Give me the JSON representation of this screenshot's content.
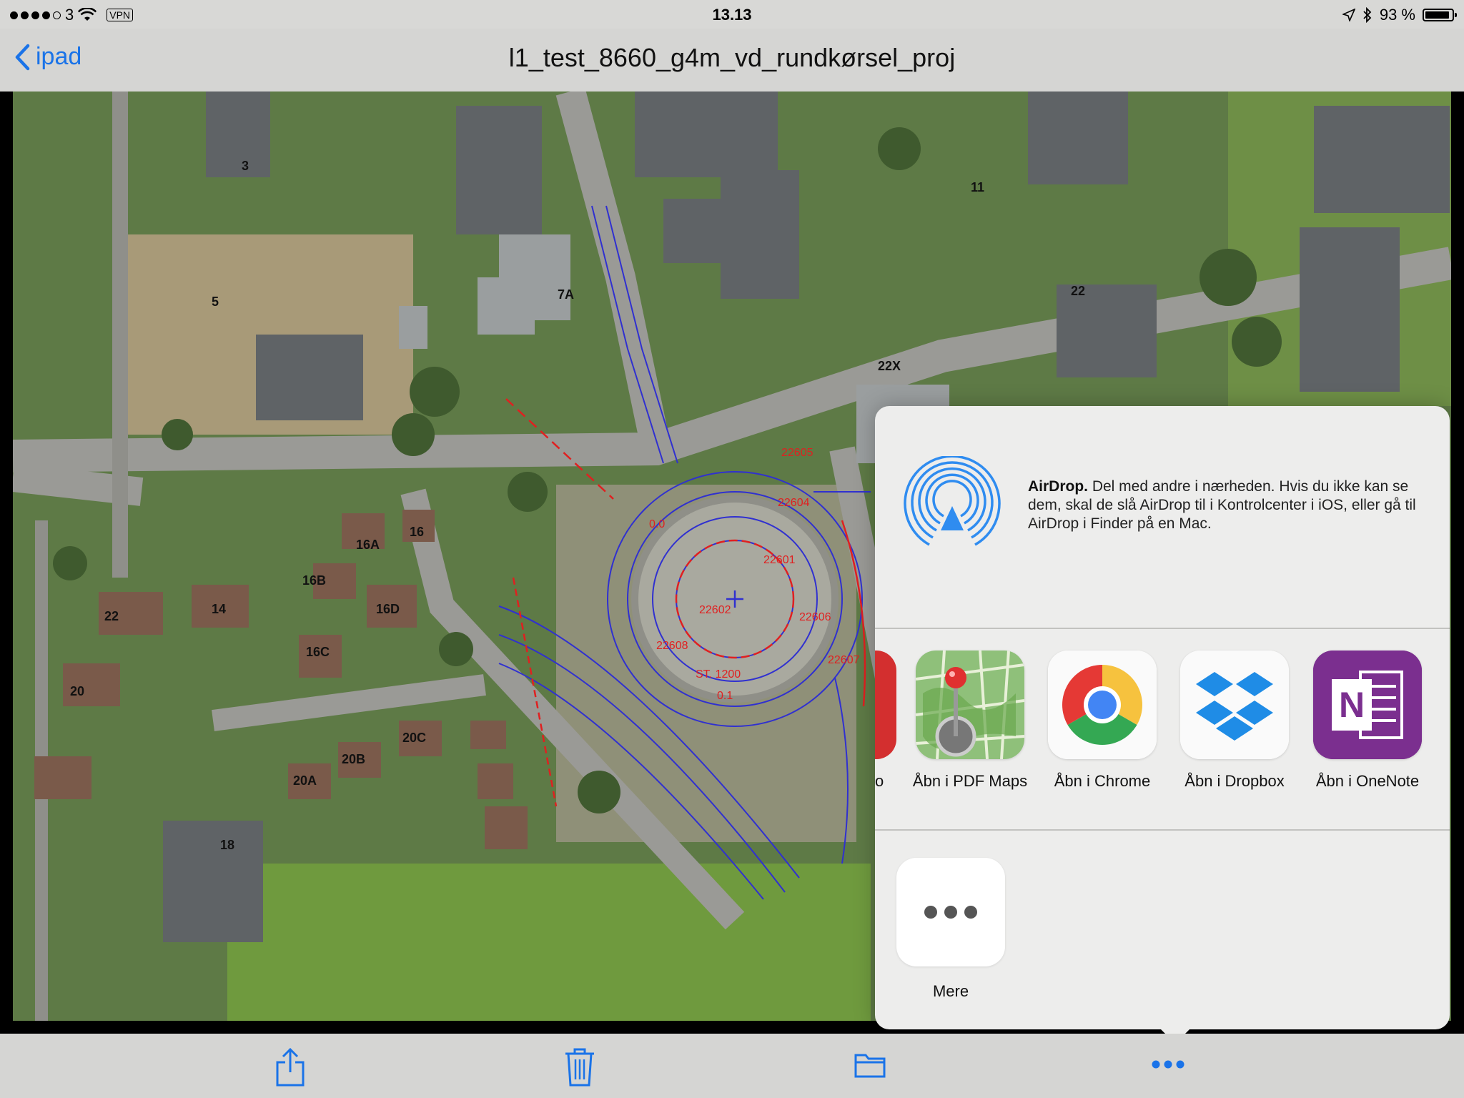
{
  "status_bar": {
    "carrier": "3",
    "vpn": "VPN",
    "time": "13.13",
    "battery": "93 %",
    "battery_level_percent": 93,
    "signal_bars": 4
  },
  "nav_bar": {
    "back_label": "ipad",
    "title": "l1_test_8660_g4m_vd_rundkørsel_proj"
  },
  "map": {
    "labels": [
      "5",
      "3",
      "7A",
      "11",
      "22",
      "22X",
      "16A",
      "16",
      "16B",
      "16D",
      "16C",
      "14",
      "22",
      "20",
      "20A",
      "20B",
      "20C",
      "18",
      "ST. 1200",
      "0.0",
      "0.1"
    ],
    "station_labels": [
      "22601",
      "22602",
      "22604",
      "22605",
      "22606",
      "22607",
      "22608"
    ]
  },
  "share_sheet": {
    "airdrop": {
      "title": "AirDrop.",
      "description": " Del med andre i nærheden. Hvis du ikke kan se dem, skal de slå AirDrop til i Kontrolcenter i iOS, eller gå til AirDrop i Finder på en Mac."
    },
    "partial_app_label": "o",
    "apps": [
      {
        "label": "Åbn i PDF Maps",
        "icon": "pdf-maps-icon"
      },
      {
        "label": "Åbn i Chrome",
        "icon": "chrome-icon"
      },
      {
        "label": "Åbn i Dropbox",
        "icon": "dropbox-icon"
      },
      {
        "label": "Åbn i OneNote",
        "icon": "onenote-icon"
      }
    ],
    "more_label": "Mere"
  },
  "toolbar": {
    "items": [
      "share-icon",
      "trash-icon",
      "folder-icon",
      "more-icon"
    ]
  },
  "colors": {
    "accent": "#1a73e8",
    "bar_bg": "#d5d5d3",
    "sheet_bg": "#ededec",
    "airdrop_blue": "#2f8cf0",
    "drawing_blue": "#3030d0",
    "drawing_red": "#e02020"
  }
}
